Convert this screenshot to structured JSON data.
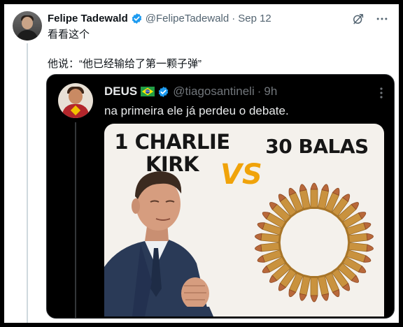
{
  "tweet": {
    "author_name": "Felipe Tadewald",
    "handle": "@FelipeTadewald",
    "separator": "·",
    "date": "Sep 12",
    "line1": "看看这个",
    "line2": "他说：“他已经输给了第一颗子弹”"
  },
  "quoted": {
    "author_name": "DEUS",
    "handle": "@tiagosantineli",
    "separator": "·",
    "time": "9h",
    "text": "na primeira ele já perdeu o debate.",
    "meme": {
      "left_line1": "1 CHARLIE",
      "left_line2": "KIRK",
      "vs": "VS",
      "right": "30 BALAS"
    }
  },
  "colors": {
    "verified": "#1d9bf0",
    "vs": "#f0a30a",
    "text_primary": "#0f1419",
    "text_secondary": "#536471"
  },
  "icons": [
    "verified-badge-icon",
    "grok-icon",
    "more-icon",
    "brazil-flag-icon"
  ]
}
